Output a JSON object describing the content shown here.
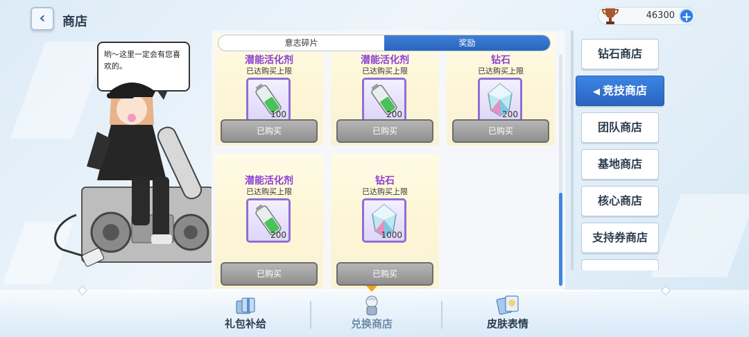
{
  "header": {
    "title": "商店",
    "currency_amount": "46300",
    "icons": {
      "back": "chevron-left-icon",
      "currency": "trophy-icon",
      "add": "plus-icon"
    }
  },
  "speech": "哟～这里一定会有您喜欢的。",
  "tabs": [
    {
      "label": "意志碎片",
      "active": false
    },
    {
      "label": "奖励",
      "active": true
    }
  ],
  "items": [
    {
      "name": "潜能活化剂",
      "limit": "已达购买上限",
      "qty": "100",
      "icon": "battery-potion-icon",
      "button": "已购买"
    },
    {
      "name": "潜能活化剂",
      "limit": "已达购买上限",
      "qty": "200",
      "icon": "battery-potion-icon",
      "button": "已购买"
    },
    {
      "name": "钻石",
      "limit": "已达购买上限",
      "qty": "200",
      "icon": "diamond-crystal-icon",
      "button": "已购买"
    },
    {
      "name": "潜能活化剂",
      "limit": "已达购买上限",
      "qty": "200",
      "icon": "battery-potion-icon",
      "button": "已购买"
    },
    {
      "name": "钻石",
      "limit": "已达购买上限",
      "qty": "1000",
      "icon": "diamond-crystal-icon",
      "button": "已购买"
    }
  ],
  "side_nav": [
    {
      "label": "钻石商店",
      "active": false
    },
    {
      "label": "竞技商店",
      "active": true
    },
    {
      "label": "团队商店",
      "active": false
    },
    {
      "label": "基地商店",
      "active": false
    },
    {
      "label": "核心商店",
      "active": false
    },
    {
      "label": "支持券商店",
      "active": false
    },
    {
      "label": "",
      "active": false
    }
  ],
  "bottom_nav": [
    {
      "label": "礼包补给",
      "icon": "gift-pack-icon",
      "active": false
    },
    {
      "label": "兑换商店",
      "icon": "character-chibi-icon",
      "active": true
    },
    {
      "label": "皮肤表情",
      "icon": "sticker-cards-icon",
      "active": false
    }
  ],
  "colors": {
    "accent": "#2f6fcf",
    "item_name": "#8b3fd2",
    "bought_button": "#9a9a9a"
  }
}
